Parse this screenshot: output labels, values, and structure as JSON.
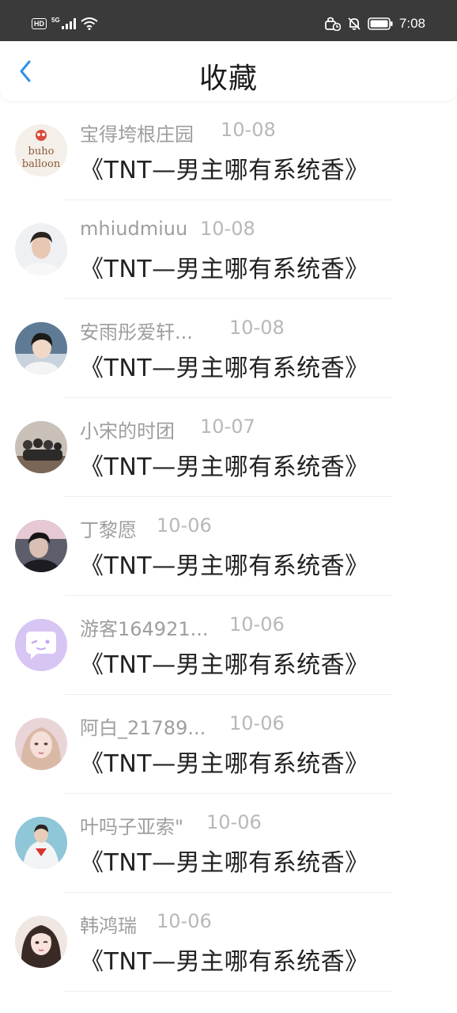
{
  "status_bar": {
    "hd": "HD",
    "network": "5G",
    "time": "7:08"
  },
  "header": {
    "title": "收藏"
  },
  "colors": {
    "accent": "#2f8fe8",
    "status_bar_bg": "#3a3a3a",
    "name_text": "#9e9e9e",
    "date_text": "#b8b8b8",
    "title_text": "#222222"
  },
  "items": [
    {
      "user": "宝得垮根庄园",
      "date": "10-08",
      "title": "《TNT—男主哪有系统香》",
      "avatar": "logo-avatar",
      "avatar_text_1": "buho",
      "avatar_text_2": "balloon"
    },
    {
      "user": "mhiudmiuu",
      "date": "10-08",
      "title": "《TNT—男主哪有系统香》",
      "avatar": "photo-avatar"
    },
    {
      "user": "安雨彤爱轩...",
      "date": "10-08",
      "title": "《TNT—男主哪有系统香》",
      "avatar": "photo-avatar"
    },
    {
      "user": "小宋的时团",
      "date": "10-07",
      "title": "《TNT—男主哪有系统香》",
      "avatar": "photo-avatar"
    },
    {
      "user": "丁黎愿",
      "date": "10-06",
      "title": "《TNT—男主哪有系统香》",
      "avatar": "photo-avatar"
    },
    {
      "user": "游客164921...",
      "date": "10-06",
      "title": "《TNT—男主哪有系统香》",
      "avatar": "chat-bubble-avatar"
    },
    {
      "user": "阿白_21789...",
      "date": "10-06",
      "title": "《TNT—男主哪有系统香》",
      "avatar": "photo-avatar"
    },
    {
      "user": "叶吗子亚索\"",
      "date": "10-06",
      "title": "《TNT—男主哪有系统香》",
      "avatar": "photo-avatar"
    },
    {
      "user": "韩鸿瑞",
      "date": "10-06",
      "title": "《TNT—男主哪有系统香》",
      "avatar": "photo-avatar"
    }
  ]
}
